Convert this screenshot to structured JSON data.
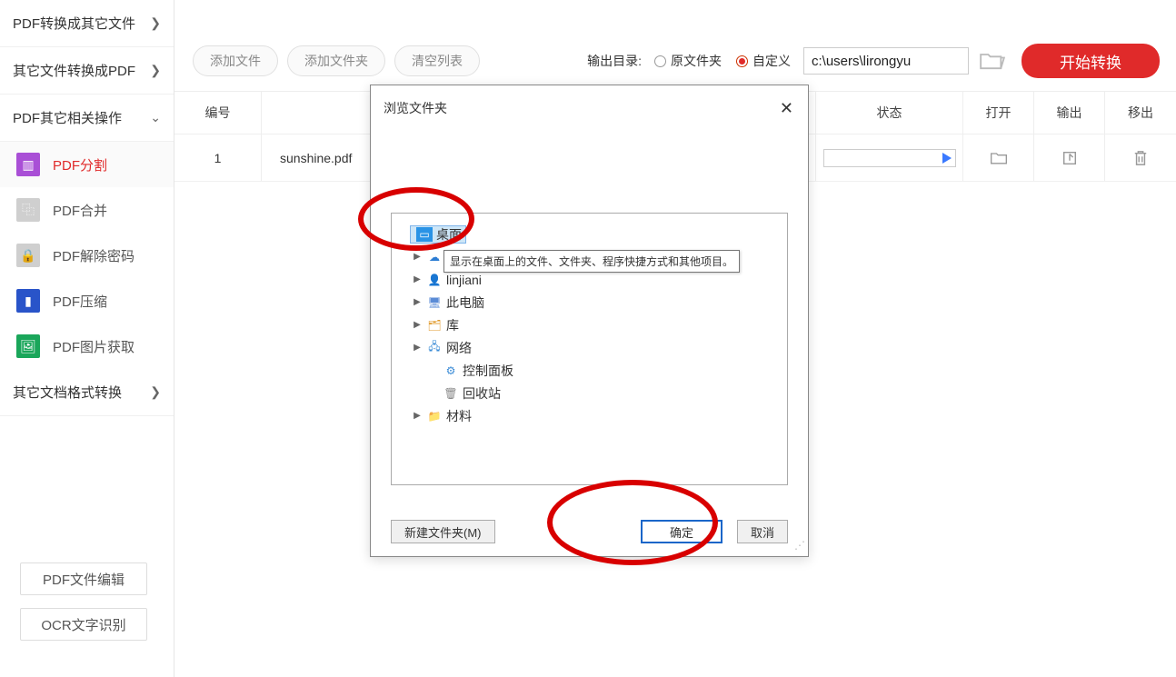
{
  "sidebar": {
    "groups": [
      {
        "label": "PDF转换成其它文件",
        "expanded": false
      },
      {
        "label": "其它文件转换成PDF",
        "expanded": false
      },
      {
        "label": "PDF其它相关操作",
        "expanded": true
      },
      {
        "label": "其它文档格式转换",
        "expanded": false
      }
    ],
    "pdf_ops": [
      {
        "label": "PDF分割",
        "icon": "split",
        "active": true
      },
      {
        "label": "PDF合并",
        "icon": "merge",
        "active": false
      },
      {
        "label": "PDF解除密码",
        "icon": "unlock",
        "active": false
      },
      {
        "label": "PDF压缩",
        "icon": "compress",
        "active": false
      },
      {
        "label": "PDF图片获取",
        "icon": "img",
        "active": false
      }
    ],
    "bottom": [
      {
        "label": "PDF文件编辑"
      },
      {
        "label": "OCR文字识别"
      }
    ]
  },
  "topbar": {
    "add_file": "添加文件",
    "add_folder": "添加文件夹",
    "clear": "清空列表",
    "output_label": "输出目录:",
    "radio_orig": "原文件夹",
    "radio_custom": "自定义",
    "path": "c:\\users\\lirongyu",
    "start": "开始转换"
  },
  "table": {
    "headers": {
      "num": "编号",
      "status": "状态",
      "open": "打开",
      "output": "输出",
      "remove": "移出"
    },
    "row": {
      "num": "1",
      "name": "sunshine.pdf"
    }
  },
  "dialog": {
    "title": "浏览文件夹",
    "tooltip": "显示在桌面上的文件、文件夹、程序快捷方式和其他项目。",
    "tree": [
      {
        "label": "桌面",
        "level": 0,
        "icon": "desktop",
        "selected": true,
        "expandable": false
      },
      {
        "label": "OneDrive",
        "level": 1,
        "icon": "onedrive",
        "expandable": true
      },
      {
        "label": "linjiani",
        "level": 1,
        "icon": "user",
        "expandable": true
      },
      {
        "label": "此电脑",
        "level": 1,
        "icon": "pc",
        "expandable": true
      },
      {
        "label": "库",
        "level": 1,
        "icon": "lib",
        "expandable": true
      },
      {
        "label": "网络",
        "level": 1,
        "icon": "net",
        "expandable": true
      },
      {
        "label": "控制面板",
        "level": 1,
        "icon": "cp",
        "expandable": false
      },
      {
        "label": "回收站",
        "level": 1,
        "icon": "bin",
        "expandable": false
      },
      {
        "label": "材料",
        "level": 1,
        "icon": "folder",
        "expandable": true
      }
    ],
    "new_folder": "新建文件夹(M)",
    "ok": "确定",
    "cancel": "取消"
  }
}
